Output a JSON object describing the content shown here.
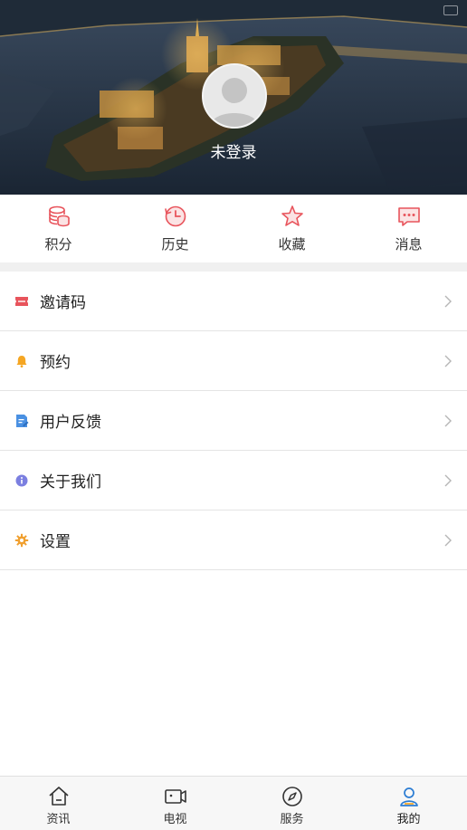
{
  "header": {
    "login_text": "未登录"
  },
  "quick_actions": [
    {
      "label": "积分",
      "icon": "coins-icon"
    },
    {
      "label": "历史",
      "icon": "history-icon"
    },
    {
      "label": "收藏",
      "icon": "star-icon"
    },
    {
      "label": "消息",
      "icon": "message-icon"
    }
  ],
  "menu": [
    {
      "label": "邀请码",
      "icon": "ticket-icon"
    },
    {
      "label": "预约",
      "icon": "bell-icon"
    },
    {
      "label": "用户反馈",
      "icon": "feedback-icon"
    },
    {
      "label": "关于我们",
      "icon": "info-icon"
    },
    {
      "label": "设置",
      "icon": "gear-icon"
    }
  ],
  "tabbar": [
    {
      "label": "资讯",
      "icon": "home-icon",
      "active": false
    },
    {
      "label": "电视",
      "icon": "tv-icon",
      "active": false
    },
    {
      "label": "服务",
      "icon": "compass-icon",
      "active": false
    },
    {
      "label": "我的",
      "icon": "user-icon",
      "active": true
    }
  ],
  "colors": {
    "accent_red": "#e8545c",
    "bell_orange": "#f5a623",
    "feedback_blue": "#4a90e2",
    "info_purple": "#7b7fe0",
    "gear_orange": "#f0a030",
    "tab_active_blue": "#2b7cd3"
  }
}
